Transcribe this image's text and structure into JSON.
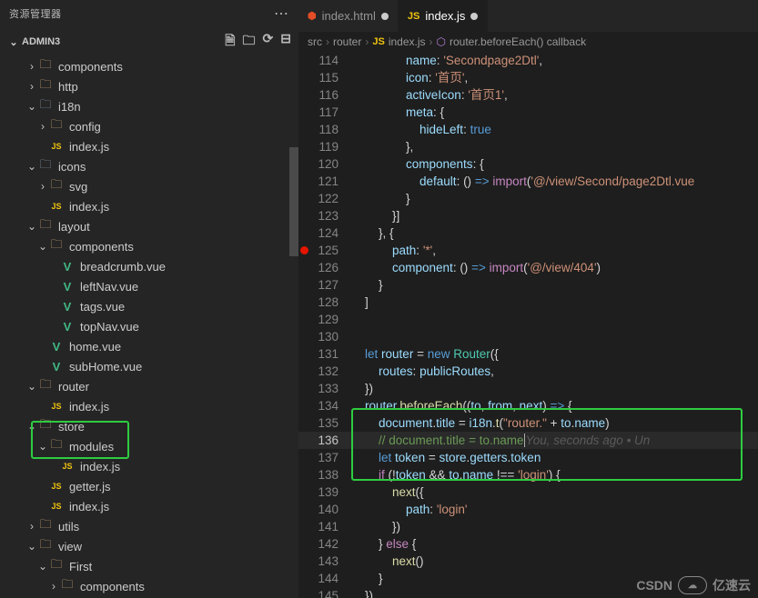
{
  "sidebar": {
    "title": "资源管理器",
    "section": "ADMIN3",
    "actions": [
      "new-file",
      "new-folder",
      "refresh",
      "collapse"
    ],
    "items": [
      {
        "d": 2,
        "tw": ">",
        "icon": "folder",
        "name": "components"
      },
      {
        "d": 2,
        "tw": ">",
        "icon": "folder",
        "name": "http"
      },
      {
        "d": 2,
        "tw": "v",
        "icon": "folder2",
        "name": "i18n"
      },
      {
        "d": 3,
        "tw": ">",
        "icon": "folder",
        "name": "config"
      },
      {
        "d": 3,
        "tw": "",
        "icon": "js",
        "name": "index.js"
      },
      {
        "d": 2,
        "tw": "v",
        "icon": "folder2",
        "name": "icons"
      },
      {
        "d": 3,
        "tw": ">",
        "icon": "folder",
        "name": "svg"
      },
      {
        "d": 3,
        "tw": "",
        "icon": "js",
        "name": "index.js"
      },
      {
        "d": 2,
        "tw": "v",
        "icon": "folder",
        "name": "layout"
      },
      {
        "d": 3,
        "tw": "v",
        "icon": "folder",
        "name": "components"
      },
      {
        "d": 4,
        "tw": "",
        "icon": "vue",
        "name": "breadcrumb.vue"
      },
      {
        "d": 4,
        "tw": "",
        "icon": "vue",
        "name": "leftNav.vue"
      },
      {
        "d": 4,
        "tw": "",
        "icon": "vue",
        "name": "tags.vue"
      },
      {
        "d": 4,
        "tw": "",
        "icon": "vue",
        "name": "topNav.vue"
      },
      {
        "d": 3,
        "tw": "",
        "icon": "vue",
        "name": "home.vue"
      },
      {
        "d": 3,
        "tw": "",
        "icon": "vue",
        "name": "subHome.vue"
      },
      {
        "d": 2,
        "tw": "v",
        "icon": "folder",
        "name": "router"
      },
      {
        "d": 3,
        "tw": "",
        "icon": "js",
        "name": "index.js"
      },
      {
        "d": 2,
        "tw": "v",
        "icon": "folder",
        "name": "store"
      },
      {
        "d": 3,
        "tw": "v",
        "icon": "folder",
        "name": "modules"
      },
      {
        "d": 4,
        "tw": "",
        "icon": "js",
        "name": "index.js"
      },
      {
        "d": 3,
        "tw": "",
        "icon": "js",
        "name": "getter.js"
      },
      {
        "d": 3,
        "tw": "",
        "icon": "js",
        "name": "index.js"
      },
      {
        "d": 2,
        "tw": ">",
        "icon": "folder",
        "name": "utils"
      },
      {
        "d": 2,
        "tw": "v",
        "icon": "folder",
        "name": "view"
      },
      {
        "d": 3,
        "tw": "v",
        "icon": "folder",
        "name": "First"
      },
      {
        "d": 4,
        "tw": ">",
        "icon": "folder",
        "name": "components"
      }
    ]
  },
  "tabs": [
    {
      "icon": "html5",
      "label": "index.html",
      "modified": true,
      "active": false
    },
    {
      "icon": "js",
      "label": "index.js",
      "modified": true,
      "active": true
    }
  ],
  "breadcrumbs": [
    "src",
    "router",
    "index.js",
    "router.beforeEach() callback"
  ],
  "code": {
    "start": 114,
    "active": 136,
    "ghost": "You, seconds ago • Un",
    "lines": [
      [
        [
          "                ",
          ""
        ],
        [
          "name",
          1
        ],
        [
          ": ",
          0
        ],
        [
          "'Secondpage2Dtl'",
          2
        ],
        [
          ",",
          0
        ]
      ],
      [
        [
          "                ",
          ""
        ],
        [
          "icon",
          1
        ],
        [
          ": ",
          0
        ],
        [
          "'首页'",
          2
        ],
        [
          ",",
          0
        ]
      ],
      [
        [
          "                ",
          ""
        ],
        [
          "activeIcon",
          1
        ],
        [
          ": ",
          0
        ],
        [
          "'首页1'",
          2
        ],
        [
          ",",
          0
        ]
      ],
      [
        [
          "                ",
          ""
        ],
        [
          "meta",
          1
        ],
        [
          ": {",
          0
        ]
      ],
      [
        [
          "                    ",
          ""
        ],
        [
          "hideLeft",
          1
        ],
        [
          ": ",
          0
        ],
        [
          "true",
          3
        ]
      ],
      [
        [
          "                },",
          0
        ]
      ],
      [
        [
          "                ",
          ""
        ],
        [
          "components",
          1
        ],
        [
          ": {",
          0
        ]
      ],
      [
        [
          "                    ",
          ""
        ],
        [
          "default",
          1
        ],
        [
          ": () ",
          0
        ],
        [
          "=>",
          3
        ],
        [
          " ",
          0
        ],
        [
          "import",
          4
        ],
        [
          "(",
          0
        ],
        [
          "'@/view/Second/page2Dtl.vue",
          2
        ]
      ],
      [
        [
          "                }",
          0
        ]
      ],
      [
        [
          "            }]",
          0
        ]
      ],
      [
        [
          "        }, {",
          0
        ]
      ],
      [
        [
          "            ",
          ""
        ],
        [
          "path",
          1
        ],
        [
          ": ",
          0
        ],
        [
          "'*'",
          2
        ],
        [
          ",",
          0
        ]
      ],
      [
        [
          "            ",
          ""
        ],
        [
          "component",
          1
        ],
        [
          ": () ",
          0
        ],
        [
          "=>",
          3
        ],
        [
          " ",
          0
        ],
        [
          "import",
          4
        ],
        [
          "(",
          0
        ],
        [
          "'@/view/404'",
          2
        ],
        [
          ")",
          0
        ]
      ],
      [
        [
          "        }",
          0
        ]
      ],
      [
        [
          "    ]",
          0
        ]
      ],
      [
        [
          "",
          0
        ]
      ],
      [
        [
          "",
          0
        ]
      ],
      [
        [
          "    ",
          ""
        ],
        [
          "let",
          3
        ],
        [
          " ",
          0
        ],
        [
          "router",
          5
        ],
        [
          " = ",
          0
        ],
        [
          "new",
          3
        ],
        [
          " ",
          0
        ],
        [
          "Router",
          6
        ],
        [
          "({",
          0
        ]
      ],
      [
        [
          "        ",
          ""
        ],
        [
          "routes",
          1
        ],
        [
          ": ",
          0
        ],
        [
          "publicRoutes",
          5
        ],
        [
          ",",
          0
        ]
      ],
      [
        [
          "    })",
          0
        ]
      ],
      [
        [
          "    ",
          ""
        ],
        [
          "router",
          5
        ],
        [
          ".",
          0
        ],
        [
          "beforeEach",
          7
        ],
        [
          "((",
          0
        ],
        [
          "to",
          5
        ],
        [
          ", ",
          0
        ],
        [
          "from",
          5
        ],
        [
          ", ",
          0
        ],
        [
          "next",
          5
        ],
        [
          ") ",
          0
        ],
        [
          "=>",
          3
        ],
        [
          " {",
          0
        ]
      ],
      [
        [
          "        ",
          ""
        ],
        [
          "document",
          5
        ],
        [
          ".",
          0
        ],
        [
          "title",
          5
        ],
        [
          " = ",
          0
        ],
        [
          "i18n",
          5
        ],
        [
          ".",
          0
        ],
        [
          "t",
          7
        ],
        [
          "(",
          0
        ],
        [
          "\"router.\"",
          2
        ],
        [
          " + ",
          0
        ],
        [
          "to",
          5
        ],
        [
          ".",
          0
        ],
        [
          "name",
          5
        ],
        [
          ")",
          0
        ]
      ],
      [
        [
          "        ",
          ""
        ],
        [
          "// document.title = to.name",
          8
        ]
      ],
      [
        [
          "        ",
          ""
        ],
        [
          "let",
          3
        ],
        [
          " ",
          0
        ],
        [
          "token",
          5
        ],
        [
          " = ",
          0
        ],
        [
          "store",
          5
        ],
        [
          ".",
          0
        ],
        [
          "getters",
          5
        ],
        [
          ".",
          0
        ],
        [
          "token",
          5
        ]
      ],
      [
        [
          "        ",
          ""
        ],
        [
          "if",
          4
        ],
        [
          " (!",
          0
        ],
        [
          "token",
          5
        ],
        [
          " && ",
          0
        ],
        [
          "to",
          5
        ],
        [
          ".",
          0
        ],
        [
          "name",
          5
        ],
        [
          " !== ",
          0
        ],
        [
          "'login'",
          2
        ],
        [
          ") {",
          0
        ]
      ],
      [
        [
          "            ",
          ""
        ],
        [
          "next",
          7
        ],
        [
          "({",
          0
        ]
      ],
      [
        [
          "                ",
          ""
        ],
        [
          "path",
          1
        ],
        [
          ": ",
          0
        ],
        [
          "'login'",
          2
        ]
      ],
      [
        [
          "            })",
          0
        ]
      ],
      [
        [
          "        } ",
          0
        ],
        [
          "else",
          4
        ],
        [
          " {",
          0
        ]
      ],
      [
        [
          "            ",
          ""
        ],
        [
          "next",
          7
        ],
        [
          "()",
          0
        ]
      ],
      [
        [
          "        }",
          0
        ]
      ],
      [
        [
          "    })",
          0
        ]
      ]
    ]
  },
  "watermark": {
    "text1": "CSDN",
    "text2": "亿速云"
  }
}
